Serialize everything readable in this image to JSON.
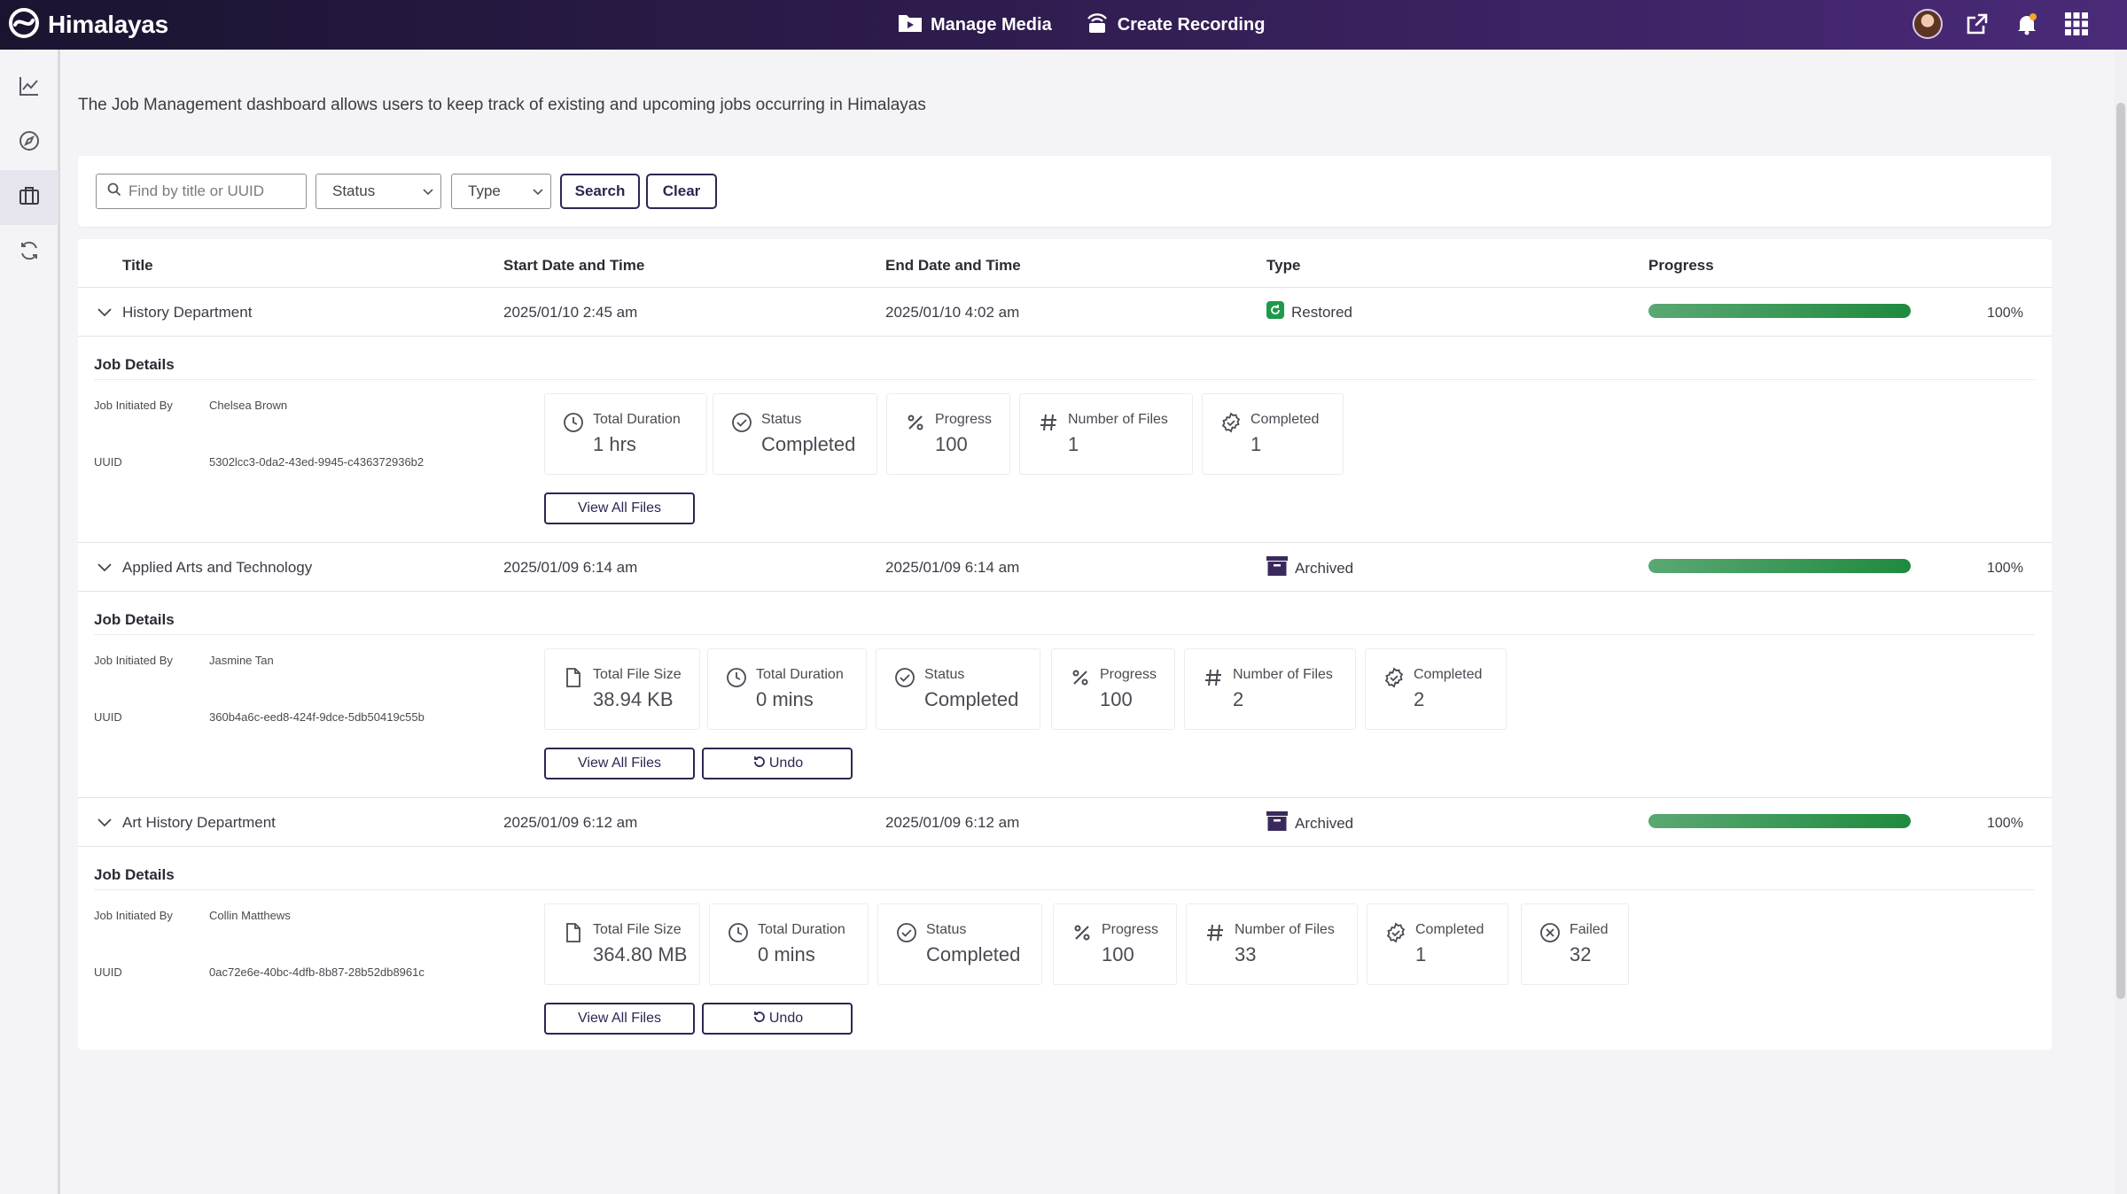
{
  "app": {
    "name": "Himalayas"
  },
  "topnav": {
    "manage_media": "Manage Media",
    "create_recording": "Create Recording"
  },
  "intro": "The Job Management dashboard allows users to keep track of existing and upcoming jobs occurring in Himalayas",
  "filters": {
    "search_placeholder": "Find by title or UUID",
    "status": "Status",
    "type": "Type",
    "search_label": "Search",
    "clear_label": "Clear"
  },
  "columns": {
    "title": "Title",
    "start": "Start Date and Time",
    "end": "End Date and Time",
    "type": "Type",
    "progress": "Progress"
  },
  "labels": {
    "job_details": "Job Details",
    "initiated_by": "Job Initiated By",
    "uuid": "UUID",
    "view_all_files": "View All Files",
    "undo": "Undo"
  },
  "jobs": [
    {
      "title": "History Department",
      "start": "2025/01/10 2:45 am",
      "end": "2025/01/10 4:02 am",
      "type": "Restored",
      "progress": 100,
      "progress_text": "100%",
      "initiated_by": "Chelsea Brown",
      "uuid": "5302lcc3-0da2-43ed-9945-c436372936b2",
      "cards": [
        {
          "icon": "clock-icon",
          "label": "Total Duration",
          "value": "1 hrs"
        },
        {
          "icon": "check-circle-icon",
          "label": "Status",
          "value": "Completed"
        },
        {
          "icon": "percent-icon",
          "label": "Progress",
          "value": "100"
        },
        {
          "icon": "hash-icon",
          "label": "Number of Files",
          "value": "1"
        },
        {
          "icon": "badge-check-icon",
          "label": "Completed",
          "value": "1"
        }
      ]
    },
    {
      "title": "Applied Arts and Technology",
      "start": "2025/01/09 6:14 am",
      "end": "2025/01/09 6:14 am",
      "type": "Archived",
      "progress": 100,
      "progress_text": "100%",
      "initiated_by": "Jasmine Tan",
      "uuid": "360b4a6c-eed8-424f-9dce-5db50419c55b",
      "cards": [
        {
          "icon": "file-icon",
          "label": "Total File Size",
          "value": "38.94 KB"
        },
        {
          "icon": "clock-icon",
          "label": "Total Duration",
          "value": "0 mins"
        },
        {
          "icon": "check-circle-icon",
          "label": "Status",
          "value": "Completed"
        },
        {
          "icon": "percent-icon",
          "label": "Progress",
          "value": "100"
        },
        {
          "icon": "hash-icon",
          "label": "Number of Files",
          "value": "2"
        },
        {
          "icon": "badge-check-icon",
          "label": "Completed",
          "value": "2"
        }
      ]
    },
    {
      "title": "Art History Department",
      "start": "2025/01/09 6:12 am",
      "end": "2025/01/09 6:12 am",
      "type": "Archived",
      "progress": 100,
      "progress_text": "100%",
      "initiated_by": "Collin Matthews",
      "uuid": "0ac72e6e-40bc-4dfb-8b87-28b52db8961c",
      "cards": [
        {
          "icon": "file-icon",
          "label": "Total File Size",
          "value": "364.80 MB"
        },
        {
          "icon": "clock-icon",
          "label": "Total Duration",
          "value": "0 mins"
        },
        {
          "icon": "check-circle-icon",
          "label": "Status",
          "value": "Completed"
        },
        {
          "icon": "percent-icon",
          "label": "Progress",
          "value": "100"
        },
        {
          "icon": "hash-icon",
          "label": "Number of Files",
          "value": "33"
        },
        {
          "icon": "badge-check-icon",
          "label": "Completed",
          "value": "1"
        },
        {
          "icon": "x-circle-icon",
          "label": "Failed",
          "value": "32"
        }
      ]
    }
  ],
  "colors": {
    "accent": "#2f2552",
    "topbar_start": "#1b1430",
    "topbar_end": "#4a2a78",
    "progress": "#1f8a3e",
    "restored": "#1f9a4a",
    "archived": "#3a2a5c"
  }
}
